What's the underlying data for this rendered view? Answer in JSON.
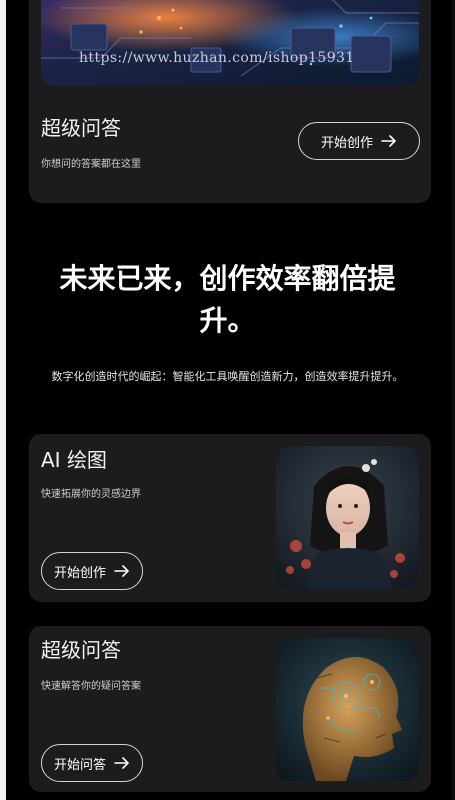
{
  "watermark": "https://www.huzhan.com/ishop15931",
  "top_card": {
    "title": "超级问答",
    "subtitle": "你想问的答案都在这里",
    "button_label": "开始创作"
  },
  "hero": {
    "headline": "未来已来，创作效率翻倍提升。",
    "subline": "数字化创造时代的崛起：智能化工具唤醒创造新力，创造效率提升提升。"
  },
  "features": [
    {
      "title": "AI 绘图",
      "subtitle": "快速拓展你的灵感边界",
      "button_label": "开始创作"
    },
    {
      "title": "超级问答",
      "subtitle": "快速解答你的疑问答案",
      "button_label": "开始问答"
    }
  ],
  "icons": {
    "button_arrow": "arrow-right-icon"
  },
  "colors": {
    "background": "#000000",
    "card": "#1c1c1e",
    "button_border": "#d6d6d6"
  }
}
